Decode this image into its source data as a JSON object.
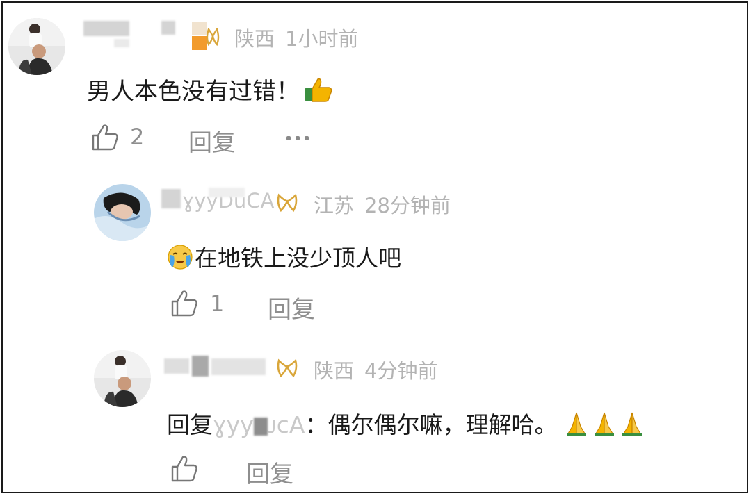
{
  "comments": [
    {
      "location": "陕西",
      "time": "1小时前",
      "text": "男人本色没有过错！",
      "likes": "2",
      "reply_label": "回复",
      "more_icon": "more-dots-icon"
    },
    {
      "username_visible": "ɣyyDuCA",
      "location": "江苏",
      "time": "28分钟前",
      "text": "在地铁上没少顶人吧",
      "likes": "1",
      "reply_label": "回复"
    },
    {
      "username_visible": "",
      "location": "陕西",
      "time": "4分钟前",
      "reply_prefix": "回复",
      "reply_target": "ɣyy",
      "reply_target_tail": "ᴊcA",
      "text": "：偶尔偶尔嘛，理解哈。",
      "likes": "",
      "reply_label": "回复"
    }
  ],
  "colors": {
    "meta": "#b3b3b3",
    "action": "#8e8e8e",
    "badge": "#d9a63a"
  }
}
